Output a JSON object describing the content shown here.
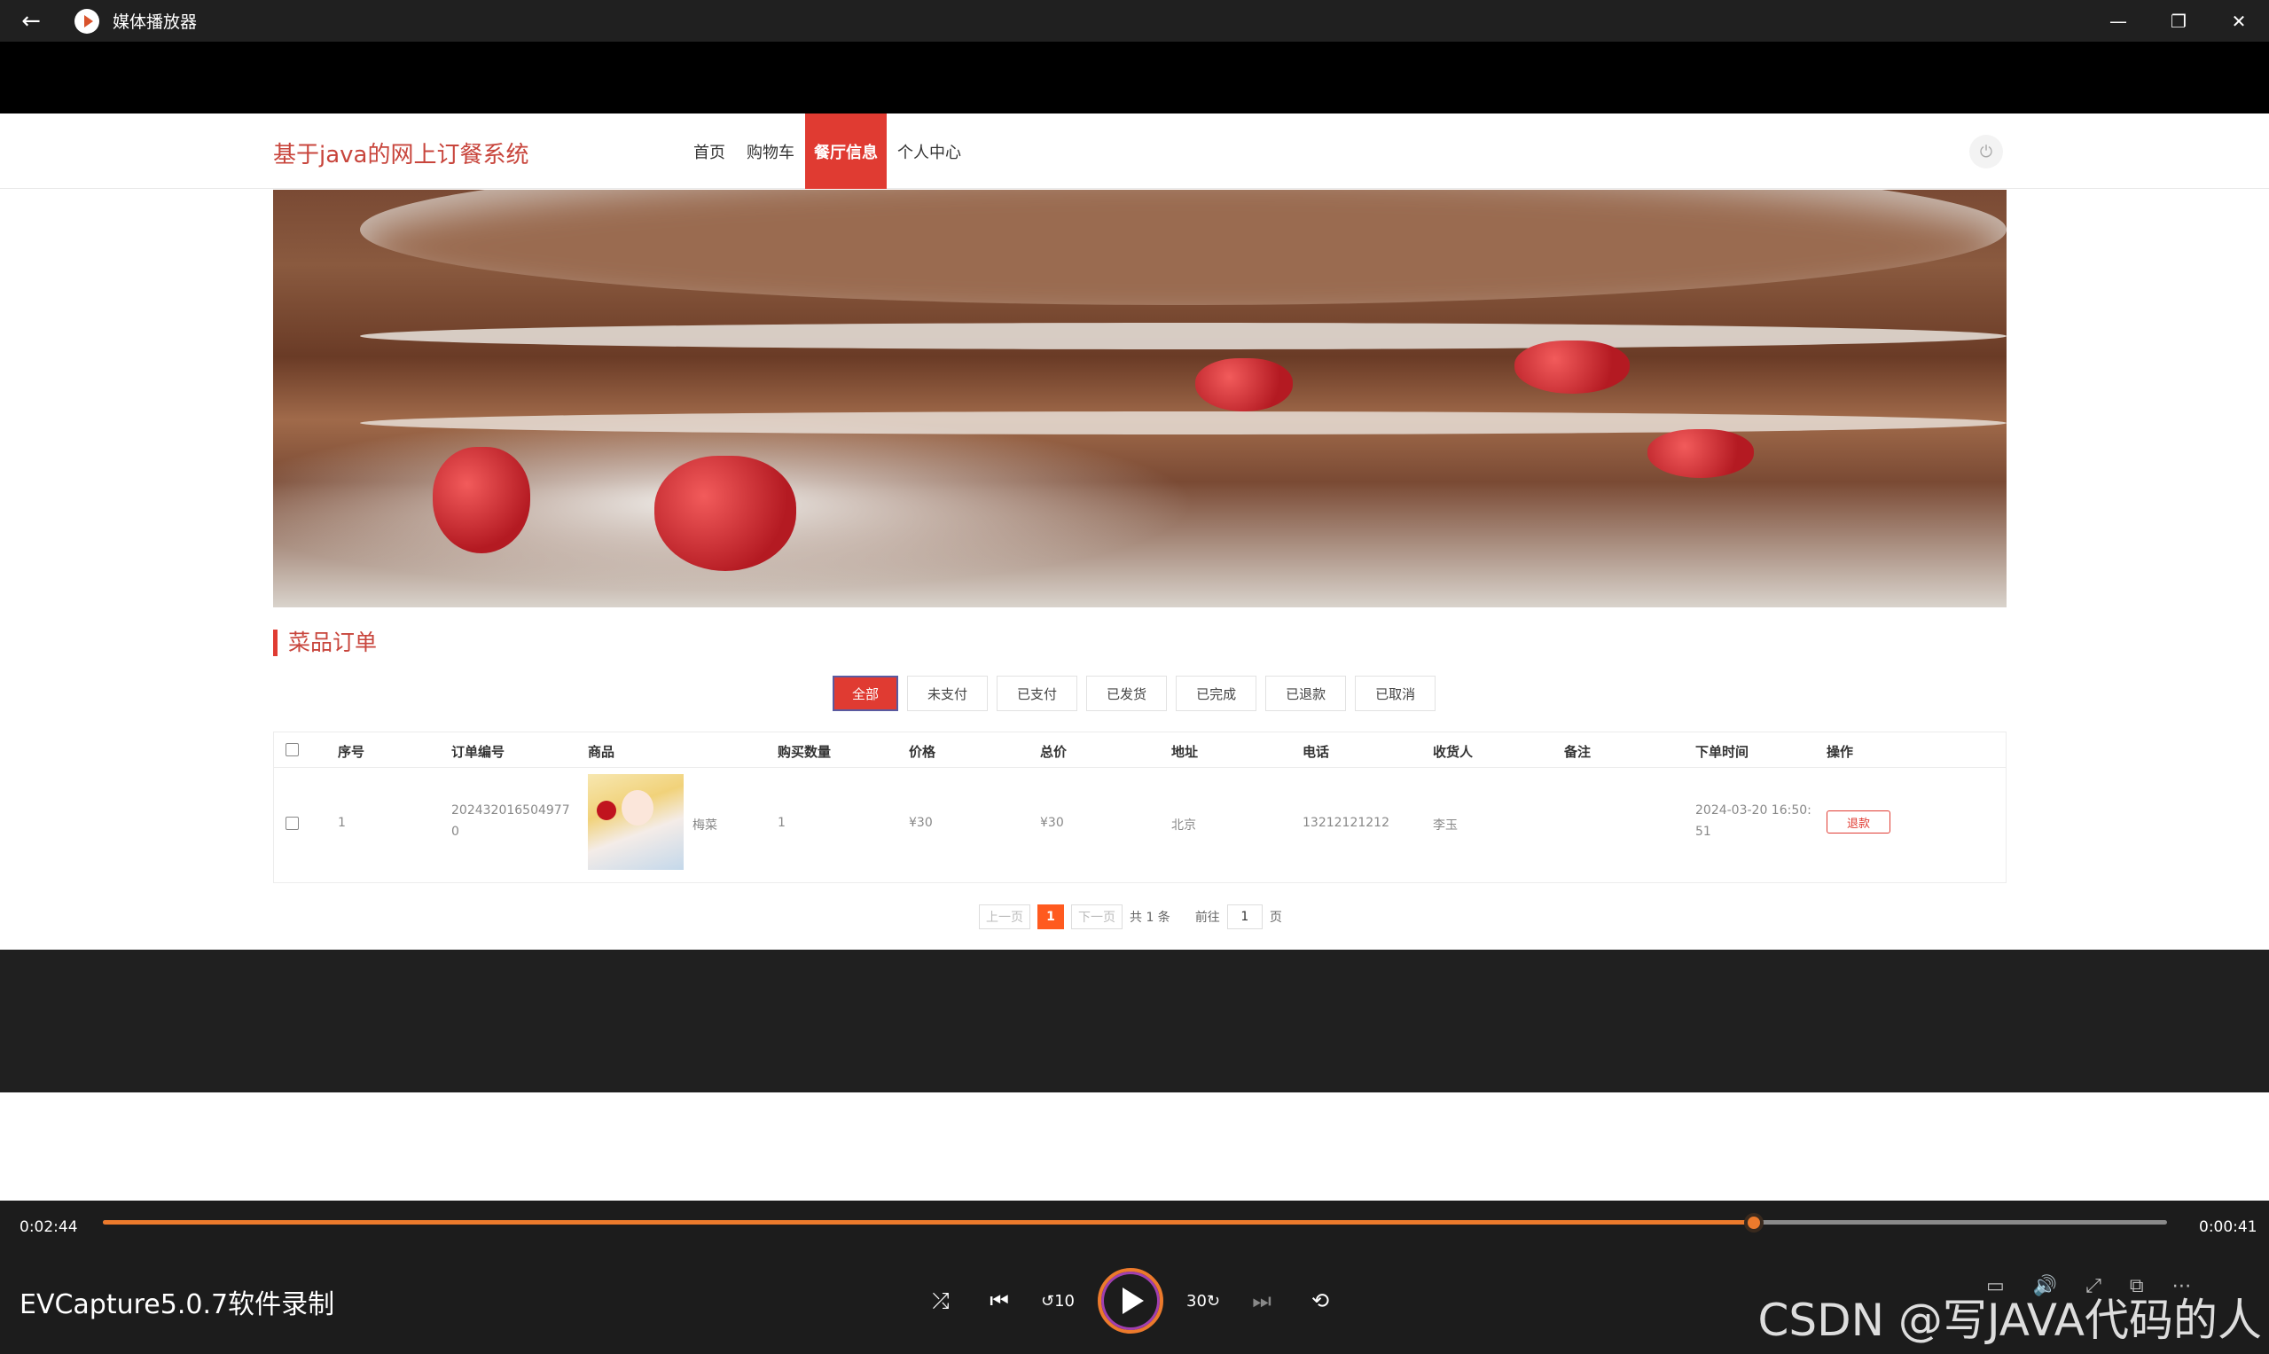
{
  "window": {
    "title": "媒体播放器"
  },
  "site": {
    "brand": "基于java的网上订餐系统",
    "nav": [
      "首页",
      "购物车",
      "餐厅信息",
      "个人中心"
    ],
    "active_nav": "餐厅信息"
  },
  "section": {
    "title": "菜品订单"
  },
  "filters": [
    "全部",
    "未支付",
    "已支付",
    "已发货",
    "已完成",
    "已退款",
    "已取消"
  ],
  "table": {
    "headers": [
      "序号",
      "订单编号",
      "商品",
      "购买数量",
      "价格",
      "总价",
      "地址",
      "电话",
      "收货人",
      "备注",
      "下单时间",
      "操作"
    ],
    "rows": [
      {
        "index": "1",
        "order_no_line1": "202432016504977",
        "order_no_line2": "0",
        "product": "梅菜",
        "quantity": "1",
        "price": "¥30",
        "total": "¥30",
        "address": "北京",
        "phone": "13212121212",
        "receiver": "李玉",
        "note": "",
        "time_line1": "2024-03-20 16:50:",
        "time_line2": "51",
        "action": "退款"
      }
    ]
  },
  "pager": {
    "prev": "上一页",
    "page": "1",
    "next": "下一页",
    "total": "共 1 条",
    "goto_label": "前往",
    "goto_value": "1",
    "unit": "页"
  },
  "player": {
    "current_time": "0:02:44",
    "remaining_time": "0:00:41",
    "progress": 0.8,
    "media_title": "EVCapture5.0.7软件录制",
    "watermark": "CSDN @写JAVA代码的人",
    "accent": "#ec7a2c"
  },
  "colors": {
    "brand_red": "#e03b32",
    "pager_orange": "#ff5a1f"
  }
}
